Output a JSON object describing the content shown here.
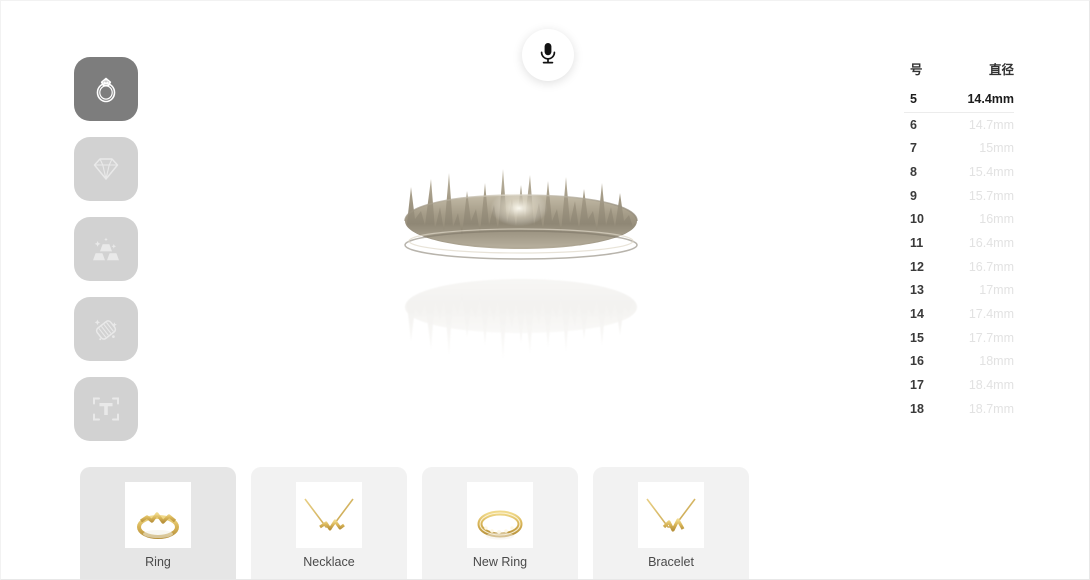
{
  "app": {
    "background": "#ffffff",
    "accent_selected": "#7d7d7d",
    "tool_idle": "#d2d2d2"
  },
  "mic": {
    "name": "microphone-record-button",
    "label": "Record voice",
    "color": "#1c1c1c"
  },
  "toolbar": {
    "items": [
      {
        "id": "ring",
        "label": "Ring",
        "icon": "ring-icon",
        "selected": true
      },
      {
        "id": "diamond",
        "label": "Diamond",
        "icon": "diamond-icon",
        "selected": false
      },
      {
        "id": "gold",
        "label": "Gold",
        "icon": "gold-bars-icon",
        "selected": false
      },
      {
        "id": "polish",
        "label": "Polish",
        "icon": "polish-cloth-icon",
        "selected": false
      },
      {
        "id": "engrave",
        "label": "Engrave Text",
        "icon": "text-scan-icon",
        "selected": false
      }
    ]
  },
  "viewport": {
    "name": "ring-3d-preview",
    "model": "soundwave-ring",
    "material_color": "#a89f8c",
    "highlight_color": "#fbf8ef"
  },
  "size_table": {
    "headers": {
      "number": "号",
      "diameter": "直径"
    },
    "selected_index": 0,
    "rows": [
      {
        "number": "5",
        "diameter": "14.4mm"
      },
      {
        "number": "6",
        "diameter": "14.7mm"
      },
      {
        "number": "7",
        "diameter": "15mm"
      },
      {
        "number": "8",
        "diameter": "15.4mm"
      },
      {
        "number": "9",
        "diameter": "15.7mm"
      },
      {
        "number": "10",
        "diameter": "16mm"
      },
      {
        "number": "11",
        "diameter": "16.4mm"
      },
      {
        "number": "12",
        "diameter": "16.7mm"
      },
      {
        "number": "13",
        "diameter": "17mm"
      },
      {
        "number": "14",
        "diameter": "17.4mm"
      },
      {
        "number": "15",
        "diameter": "17.7mm"
      },
      {
        "number": "16",
        "diameter": "18mm"
      },
      {
        "number": "17",
        "diameter": "18.4mm"
      },
      {
        "number": "18",
        "diameter": "18.7mm"
      }
    ]
  },
  "products": [
    {
      "id": "ring",
      "label": "Ring",
      "thumb": "gold-ring-thumb",
      "selected": true
    },
    {
      "id": "necklace",
      "label": "Necklace",
      "thumb": "gold-necklace-thumb",
      "selected": false
    },
    {
      "id": "new-ring",
      "label": "New Ring",
      "thumb": "gold-band-thumb",
      "selected": false
    },
    {
      "id": "bracelet",
      "label": "Bracelet",
      "thumb": "gold-bracelet-thumb",
      "selected": false
    }
  ]
}
